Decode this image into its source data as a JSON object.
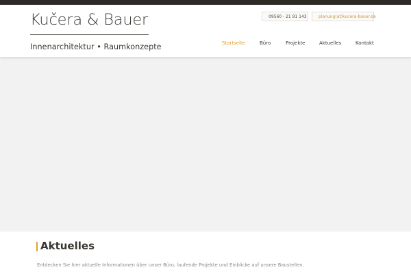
{
  "brand": {
    "name": "Kučera & Bauer",
    "tagline": "Innenarchitektur • Raumkonzepte"
  },
  "contact": {
    "phone": "09560 - 21 91 143",
    "email": "planung(at)kucera-bauer.de"
  },
  "nav": {
    "items": [
      "Startseite",
      "Büro",
      "Projekte",
      "Aktuelles",
      "Kontakt"
    ],
    "active": "Startseite"
  },
  "section": {
    "heading": "Aktuelles",
    "text": "Entdecken Sie hier aktuelle Informationen über unser Büro, laufende Projekte und Einblicke auf unsere Baustellen."
  },
  "colors": {
    "accent": "#e3a12c",
    "topbar": "#2e2b26",
    "hero_background": "#f2f2f2",
    "text": "#3a3733"
  },
  "icons": {
    "phone": "phone-icon",
    "mail": "envelope-icon"
  }
}
